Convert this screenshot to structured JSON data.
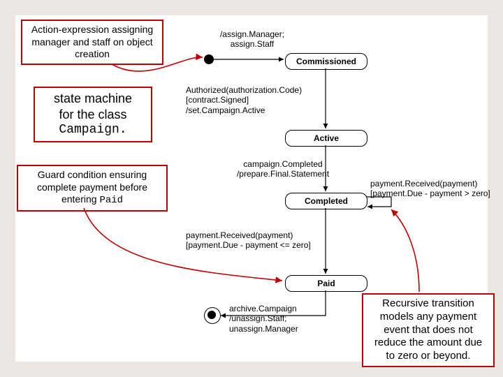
{
  "callouts": {
    "top_left": "Action-expression assigning manager and staff on object creation",
    "middle_left_line1": "state machine",
    "middle_left_line2": "for the class",
    "middle_left_code": "Campaign.",
    "bottom_left_line1": "Guard condition ensuring",
    "bottom_left_line2": "complete payment before",
    "bottom_left_line3_a": "entering ",
    "bottom_left_line3_b": "Paid",
    "bottom_right": "Recursive transition models any payment event that does not reduce the amount due to zero or beyond."
  },
  "states": {
    "commissioned": "Commissioned",
    "active": "Active",
    "completed": "Completed",
    "paid": "Paid"
  },
  "labels": {
    "entry": "/assign.Manager;\nassign.Staff",
    "authorized": "Authorized(authorization.Code)\n[contract.Signed]\n/set.Campaign.Active",
    "campaign_completed": "campaign.Completed\n/prepare.Final.Statement",
    "payment_received_loop": "payment.Received(payment)\n[payment.Due - payment > zero]",
    "payment_received_exit": "payment.Received(payment)\n[payment.Due - payment <= zero]",
    "archive": "archive.Campaign\n/unassign.Staff;\nunassign.Manager"
  }
}
